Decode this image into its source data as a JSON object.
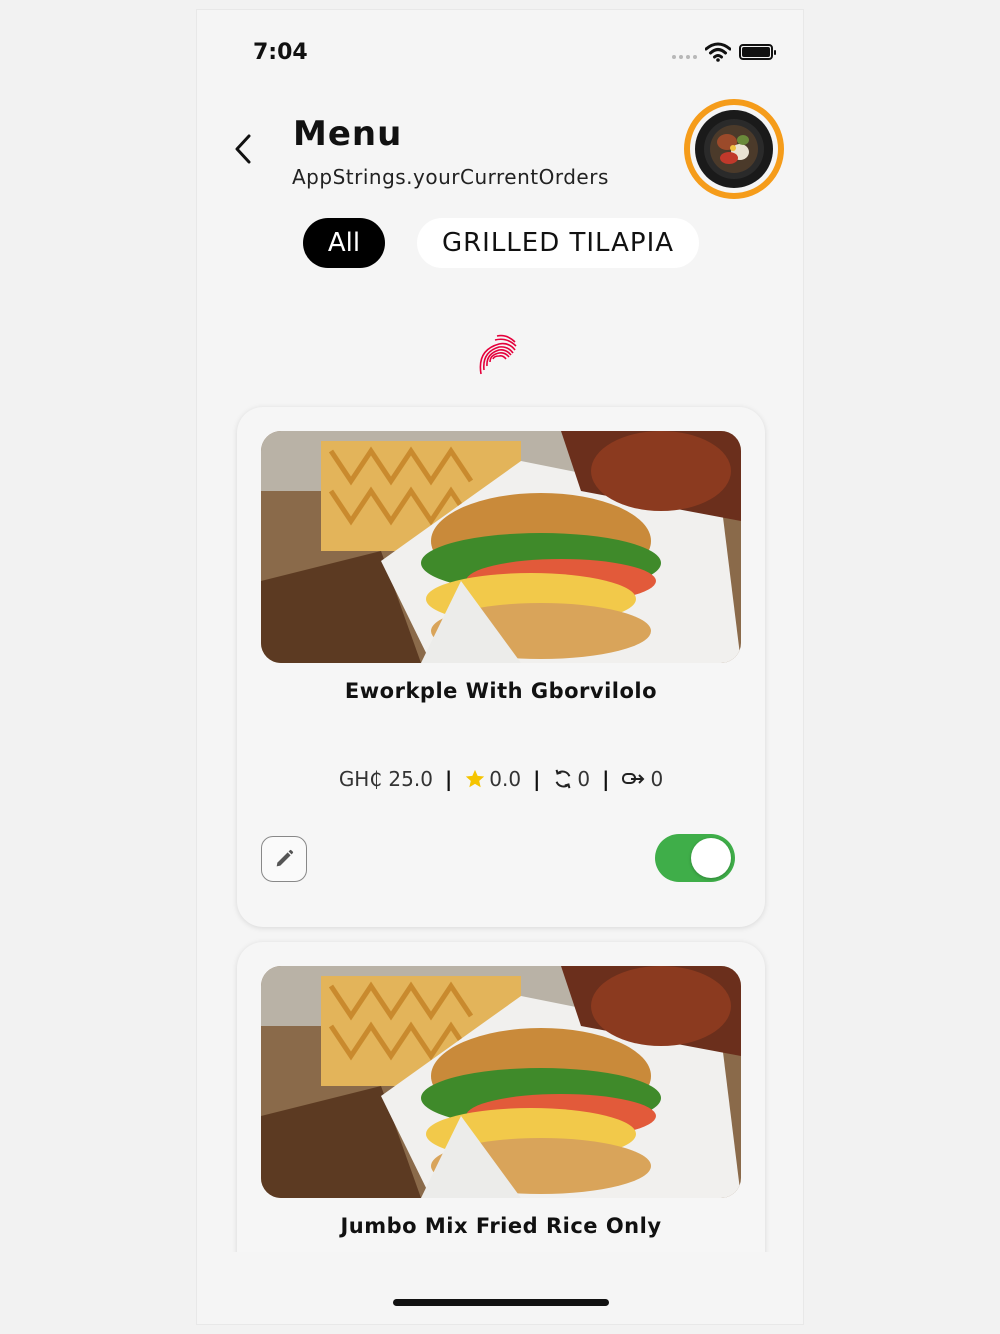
{
  "status_bar": {
    "time": "7:04"
  },
  "header": {
    "title": "Menu",
    "subtitle": "AppStrings.yourCurrentOrders"
  },
  "tabs": [
    {
      "label": "All",
      "active": true
    },
    {
      "label": "GRILLED TILAPIA",
      "active": false
    }
  ],
  "colors": {
    "accent": "#f59c1a",
    "toggle_on": "#3fae49",
    "star": "#f5c400",
    "spinner": "#e4003b"
  },
  "items": [
    {
      "name": "Eworkple With Gborvilolo",
      "price": "GH₵ 25.0",
      "rating": "0.0",
      "reorders": "0",
      "shares": "0",
      "available": true,
      "separator": "|"
    },
    {
      "name": "Jumbo Mix Fried Rice Only"
    }
  ]
}
